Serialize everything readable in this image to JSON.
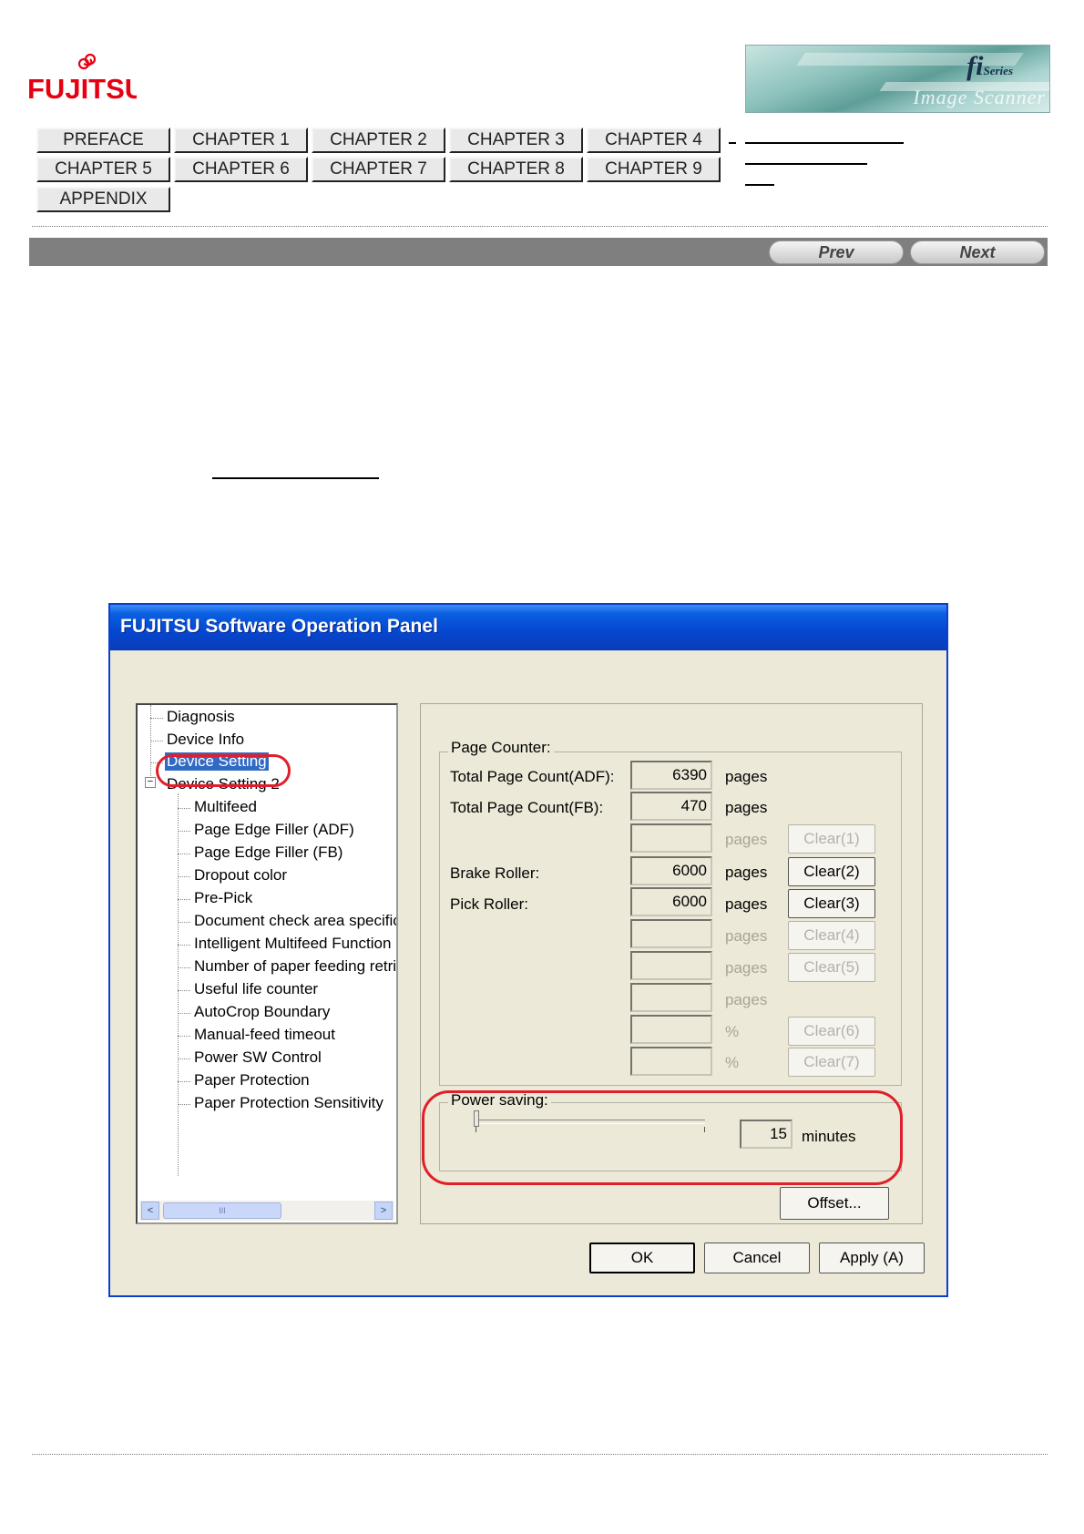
{
  "brand": {
    "logo_text": "FUJITSU"
  },
  "banner": {
    "series_text": "fi",
    "series_small": "Series",
    "subtitle": "Image Scanner"
  },
  "nav": {
    "row1": [
      "PREFACE",
      "CHAPTER 1",
      "CHAPTER 2",
      "CHAPTER 3",
      "CHAPTER 4"
    ],
    "row2": [
      "CHAPTER 5",
      "CHAPTER 6",
      "CHAPTER 7",
      "CHAPTER 8",
      "CHAPTER 9"
    ],
    "row3": [
      "APPENDIX"
    ]
  },
  "pager": {
    "prev": "Prev",
    "next": "Next"
  },
  "dialog": {
    "title": "FUJITSU Software Operation Panel",
    "tree": [
      "Diagnosis",
      "Device Info",
      "Device Setting",
      "Device Setting 2",
      "Multifeed",
      "Page Edge Filler (ADF)",
      "Page Edge Filler (FB)",
      "Dropout color",
      "Pre-Pick",
      "Document check area specific",
      "Intelligent Multifeed Function",
      "Number of paper feeding retrie",
      "Useful life counter",
      "AutoCrop Boundary",
      "Manual-feed timeout",
      "Power SW Control",
      "Paper Protection",
      "Paper Protection Sensitivity"
    ],
    "expander": "−",
    "scroll": {
      "left": "<",
      "right": ">",
      "thumb": "III"
    },
    "page_counter": {
      "label": "Page Counter:",
      "rows": [
        {
          "label": "Total Page Count(ADF):",
          "value": "6390",
          "unit": "pages",
          "button": ""
        },
        {
          "label": "Total Page Count(FB):",
          "value": "470",
          "unit": "pages",
          "button": ""
        },
        {
          "label": "",
          "value": "",
          "unit": "pages",
          "button": "Clear(1)"
        },
        {
          "label": "Brake Roller:",
          "value": "6000",
          "unit": "pages",
          "button": "Clear(2)"
        },
        {
          "label": "Pick Roller:",
          "value": "6000",
          "unit": "pages",
          "button": "Clear(3)"
        },
        {
          "label": "",
          "value": "",
          "unit": "pages",
          "button": "Clear(4)"
        },
        {
          "label": "",
          "value": "",
          "unit": "pages",
          "button": "Clear(5)"
        },
        {
          "label": "",
          "value": "",
          "unit": "pages",
          "button": ""
        },
        {
          "label": "",
          "value": "",
          "unit": "%",
          "button": "Clear(6)"
        },
        {
          "label": "",
          "value": "",
          "unit": "%",
          "button": "Clear(7)"
        }
      ]
    },
    "power_saving": {
      "label": "Power saving:",
      "value": "15",
      "unit": "minutes",
      "slider_level": 0.0
    },
    "offset_button": "Offset...",
    "ok_button": "OK",
    "cancel_button": "Cancel",
    "apply_button": "Apply (A)"
  }
}
